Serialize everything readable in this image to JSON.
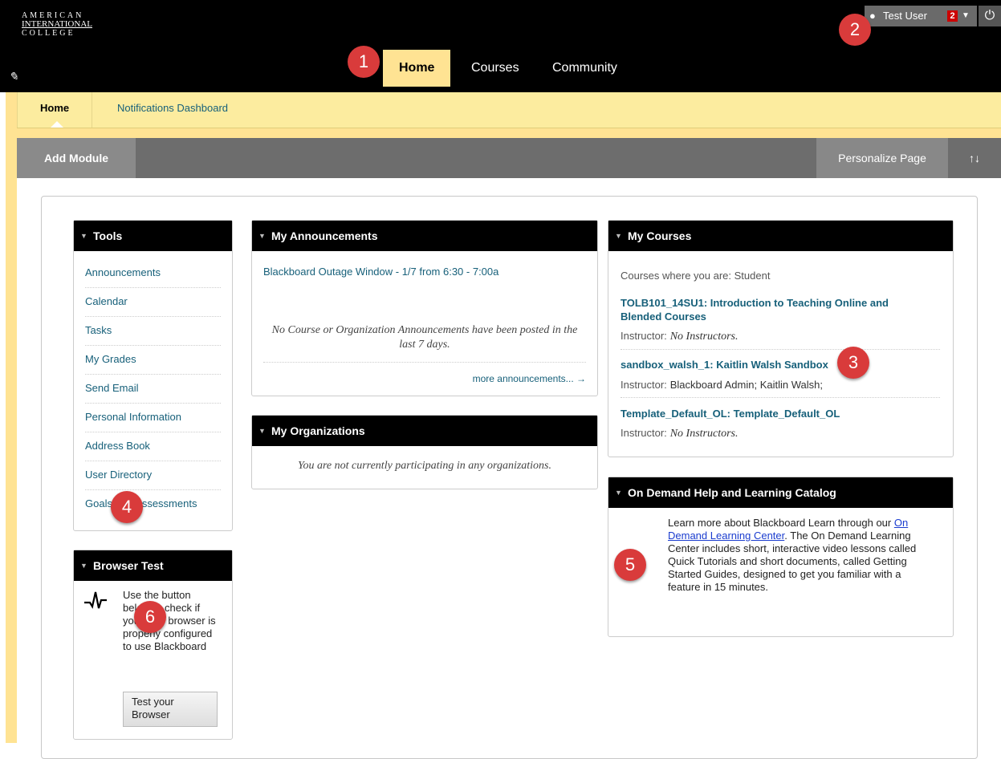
{
  "header": {
    "logo": {
      "line1": "AMERICAN",
      "line2": "INTERNATIONAL",
      "line3": "COLLEGE"
    },
    "tabs": [
      {
        "label": "Home"
      },
      {
        "label": "Courses"
      },
      {
        "label": "Community"
      }
    ],
    "user": {
      "name": "Test User",
      "notification_count": "2"
    }
  },
  "subnav": {
    "tabs": [
      {
        "label": "Home"
      },
      {
        "label": "Notifications Dashboard"
      }
    ]
  },
  "actionbar": {
    "add_module": "Add Module",
    "personalize": "Personalize Page",
    "sort_icon": "↑↓"
  },
  "modules": {
    "tools": {
      "title": "Tools",
      "items": [
        "Announcements",
        "Calendar",
        "Tasks",
        "My Grades",
        "Send Email",
        "Personal Information",
        "Address Book",
        "User Directory",
        "Goals and Assessments"
      ]
    },
    "browser_test": {
      "title": "Browser Test",
      "text": "Use the button below to check if your web browser is properly configured to use Blackboard",
      "button": "Test your Browser"
    },
    "announcements": {
      "title": "My Announcements",
      "link": "Blackboard Outage Window - 1/7 from 6:30 - 7:00a",
      "empty_message": "No Course or Organization Announcements have been posted in the last 7 days.",
      "more": "more announcements... →"
    },
    "organizations": {
      "title": "My Organizations",
      "empty_message": "You are not currently participating in any organizations."
    },
    "courses": {
      "title": "My Courses",
      "intro": "Courses where you are: Student",
      "instructor_label": "Instructor:",
      "items": [
        {
          "title": "TOLB101_14SU1: Introduction to Teaching Online and Blended Courses",
          "instructor": "No Instructors."
        },
        {
          "title": "sandbox_walsh_1: Kaitlin Walsh Sandbox",
          "instructor": "Blackboard Admin;  Kaitlin Walsh;"
        },
        {
          "title": "Template_Default_OL: Template_Default_OL",
          "instructor": "No Instructors."
        }
      ]
    },
    "help": {
      "title": "On Demand Help and Learning Catalog",
      "text_before": "Learn more about Blackboard Learn through our ",
      "link": "On Demand Learning Center",
      "text_after": ". The On Demand Learning Center includes short, interactive video lessons called Quick Tutorials and short documents, called Getting Started Guides, designed to get you familiar with a feature in 15 minutes."
    }
  },
  "callouts": [
    "1",
    "2",
    "3",
    "4",
    "5",
    "6"
  ],
  "colors": {
    "link": "#17607a",
    "tab_active": "#ffe393",
    "callout": "#d93b3b"
  }
}
